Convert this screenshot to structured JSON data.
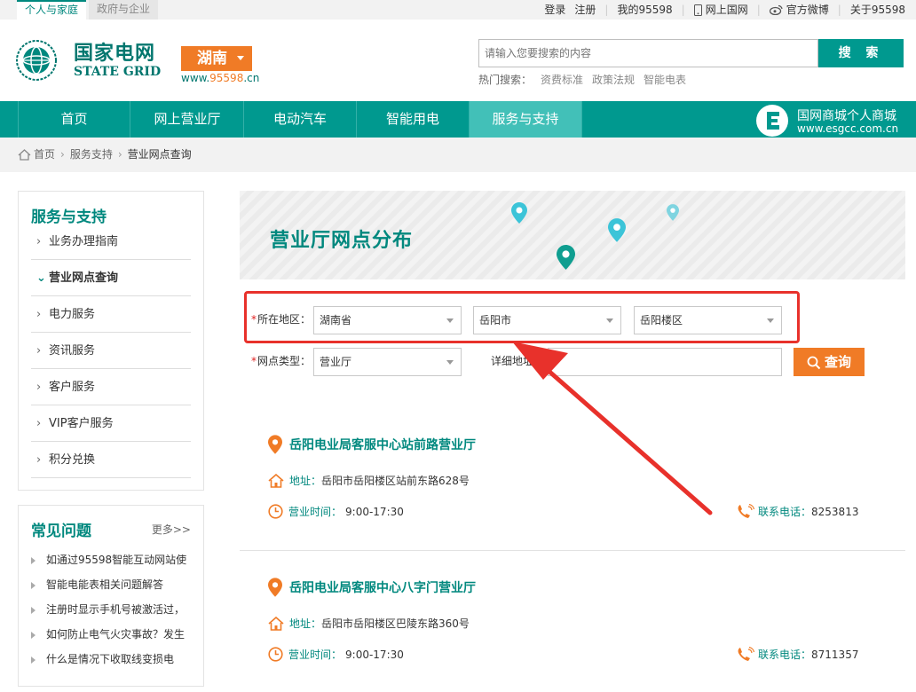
{
  "topbar": {
    "tab_personal": "个人与家庭",
    "tab_business": "政府与企业",
    "login": "登录",
    "register": "注册",
    "my95598": "我的95598",
    "mobile": "网上国网",
    "weibo": "官方微博",
    "about": "关于95598"
  },
  "header": {
    "logo_cn": "国家电网",
    "logo_en": "STATE GRID",
    "province": "湖南",
    "url_prefix": "www.",
    "url_num": "95598",
    "url_suffix": ".cn",
    "search_placeholder": "请输入您要搜索的内容",
    "search_button": "搜 索",
    "hot_label": "热门搜索：",
    "hot_links": [
      "资费标准",
      "政策法规",
      "智能电表"
    ]
  },
  "nav": {
    "items": [
      "首页",
      "网上营业厅",
      "电动汽车",
      "智能用电",
      "服务与支持"
    ],
    "mall_name": "国网商城个人商城",
    "mall_url": "www.esgcc.com.cn"
  },
  "breadcrumb": {
    "home": "首页",
    "level1": "服务支持",
    "current": "营业网点查询"
  },
  "sidebar": {
    "title": "服务与支持",
    "items": [
      "业务办理指南",
      "营业网点查询",
      "电力服务",
      "资讯服务",
      "客户服务",
      "VIP客户服务",
      "积分兑换"
    ]
  },
  "faq": {
    "title": "常见问题",
    "more": "更多>>",
    "items": [
      "如通过95598智能互动网站使",
      "智能电能表相关问题解答",
      "注册时显示手机号被激活过，",
      "如何防止电气火灾事故？发生",
      "什么是情况下收取线变损电"
    ]
  },
  "banner": {
    "title": "营业厅网点分布"
  },
  "form": {
    "region_label": "所在地区：",
    "province": "湖南省",
    "city": "岳阳市",
    "district": "岳阳楼区",
    "type_label": "网点类型：",
    "type_value": "营业厅",
    "addr_label": "详细地址：",
    "addr_value": "",
    "query_button": "查询"
  },
  "results": [
    {
      "name": "岳阳电业局客服中心站前路营业厅",
      "addr_label": "地址：",
      "address": "岳阳市岳阳楼区站前东路628号",
      "hours_label": "营业时间：",
      "hours": "9:00-17:30",
      "phone_label": "联系电话：",
      "phone": "8253813"
    },
    {
      "name": "岳阳电业局客服中心八字门营业厅",
      "addr_label": "地址：",
      "address": "岳阳市岳阳楼区巴陵东路360号",
      "hours_label": "营业时间：",
      "hours": "9:00-17:30",
      "phone_label": "联系电话：",
      "phone": "8711357"
    }
  ],
  "colors": {
    "brand_teal": "#00998f",
    "accent_orange": "#f07b26",
    "highlight_red": "#e8312b"
  }
}
